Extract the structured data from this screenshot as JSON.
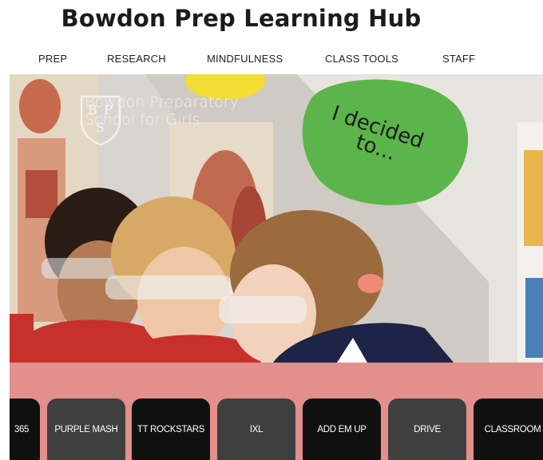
{
  "site": {
    "title": "Bowdon Prep Learning Hub"
  },
  "nav": [
    {
      "label": "PREP"
    },
    {
      "label": "RESEARCH"
    },
    {
      "label": "MINDFULNESS"
    },
    {
      "label": "CLASS TOOLS"
    },
    {
      "label": "STAFF"
    }
  ],
  "hero": {
    "logo_monogram": "BPS",
    "logo_line1": "Bowdon Preparatory",
    "logo_line2": "School for Girls",
    "board_text_line1": "I decided",
    "board_text_line2": "to..."
  },
  "tools": [
    {
      "label": "365",
      "style": "dark"
    },
    {
      "label": "PURPLE MASH",
      "style": "grey"
    },
    {
      "label": "TT ROCKSTARS",
      "style": "dark"
    },
    {
      "label": "IXL",
      "style": "grey"
    },
    {
      "label": "ADD EM UP",
      "style": "dark"
    },
    {
      "label": "DRIVE",
      "style": "grey"
    },
    {
      "label": "CLASSROOM",
      "style": "dark"
    }
  ],
  "colors": {
    "band": "#e38f8c",
    "tile_dark": "#101010",
    "tile_grey": "#3f3f3f"
  }
}
